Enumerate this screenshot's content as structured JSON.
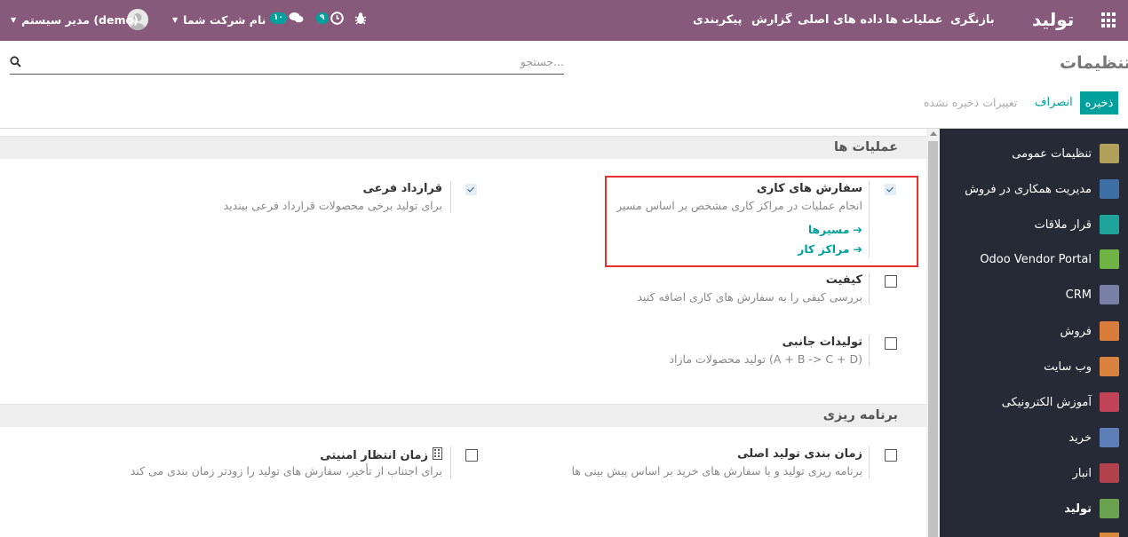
{
  "topbar": {
    "brand": "تولید",
    "menu": [
      "بازنگری",
      "عملیات ها",
      "داده های اصلی",
      "گزارش",
      "پیکربندی"
    ],
    "activities_badge": "۹",
    "messages_badge": "۱۰",
    "company": "نام شرکت شما",
    "user": "مدیر سیستم (demo)"
  },
  "control": {
    "page_title": "تنظیمات",
    "search_placeholder": "جستجو...",
    "save_label": "ذخیره",
    "cancel_label": "انصراف",
    "unsaved_label": "تغییرات ذخیره نشده"
  },
  "sidebar": {
    "items": [
      {
        "label": "تنظیمات عمومی",
        "color": "#b0a05a",
        "active": false
      },
      {
        "label": "مدیریت همکاری در فروش",
        "color": "#3d6fa5",
        "active": false
      },
      {
        "label": "قرار ملاقات",
        "color": "#1ea49a",
        "active": false
      },
      {
        "label": "Odoo Vendor Portal",
        "color": "#6fb344",
        "active": false
      },
      {
        "label": "CRM",
        "color": "#7880a8",
        "active": false
      },
      {
        "label": "فروش",
        "color": "#d97d3c",
        "active": false
      },
      {
        "label": "وب سایت",
        "color": "#d9823f",
        "active": false
      },
      {
        "label": "آموزش الکترونیکی",
        "color": "#c04356",
        "active": false
      },
      {
        "label": "خرید",
        "color": "#5b7fb6",
        "active": false
      },
      {
        "label": "انبار",
        "color": "#b2424e",
        "active": false
      },
      {
        "label": "تولید",
        "color": "#6aa34f",
        "active": true
      }
    ]
  },
  "sections": {
    "operations": {
      "title": "عملیات ها",
      "work_orders": {
        "title": "سفارش های کاری",
        "desc": "انجام عملیات در مراکز کاری مشخص بر اساس مسیر",
        "link_routings": "مسیرها",
        "link_workcenters": "مراکز کار",
        "checked": true
      },
      "subcontracting": {
        "title": "قرارداد فرعی",
        "desc": "برای تولید برخی محصولات قرارداد فرعی ببندید",
        "checked": true
      },
      "quality": {
        "title": "کیفیت",
        "desc": "بررسی کیفی را به سفارش های کاری اضافه کنید",
        "checked": false
      },
      "byproducts": {
        "title": "تولیدات جانبی",
        "desc": "تولید محصولات مازاد (A + B -> C + D)",
        "checked": false
      }
    },
    "planning": {
      "title": "برنامه ریزی",
      "mps": {
        "title": "زمان بندی تولید اصلی",
        "desc": "برنامه ریزی تولید و یا سفارش های خرید بر اساس پیش بینی ها",
        "checked": false
      },
      "security_lead": {
        "title": "زمان انتظار امنیتی",
        "desc": "برای اجتناب از تأخیر، سفارش های تولید را زودتر زمان بندی می کند",
        "checked": false
      }
    }
  }
}
